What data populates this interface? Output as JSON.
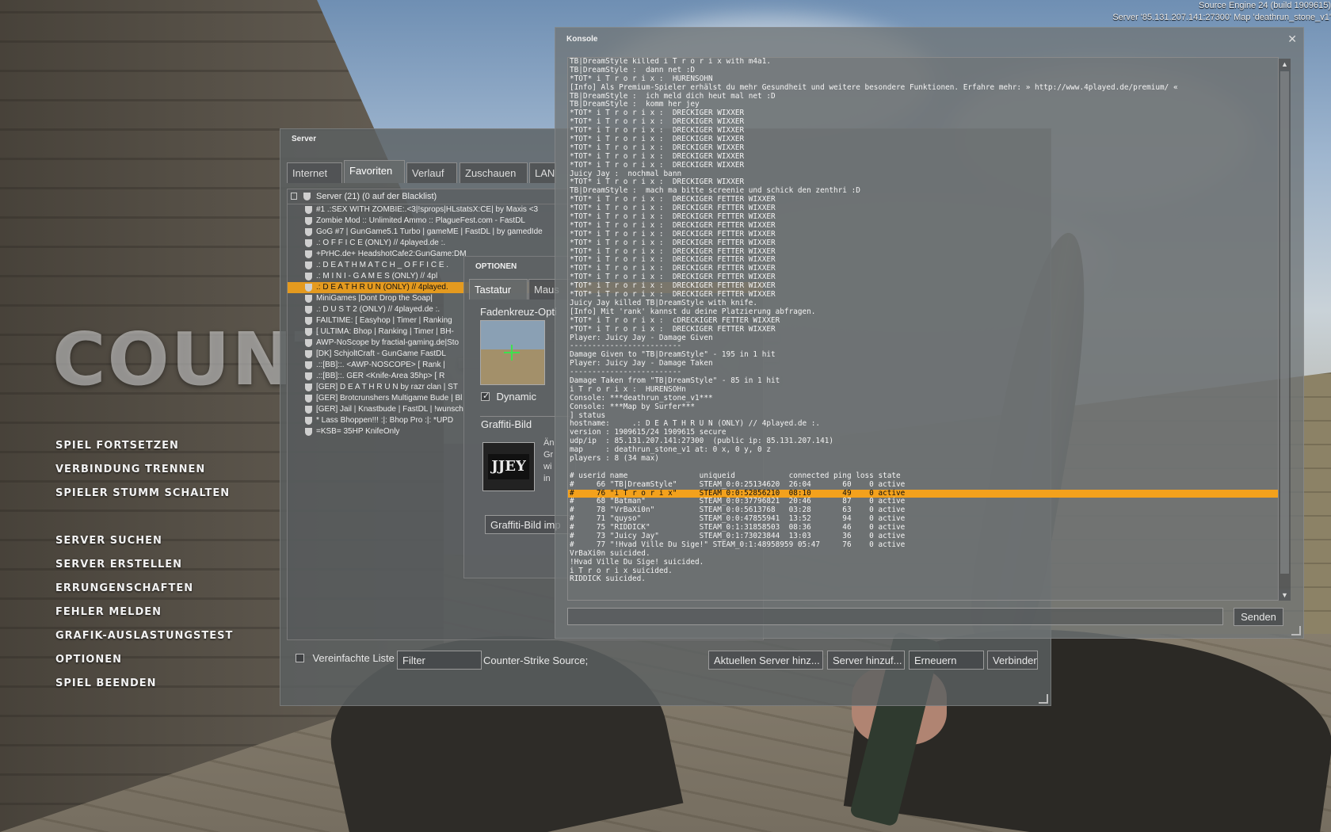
{
  "engine": {
    "line1": "Source Engine 24 (build 1909615)",
    "line2": "Server '85.131.207.141:27300' Map 'deathrun_stone_v1'"
  },
  "logo": "COUNTER-STRIKE",
  "menu": {
    "group1": [
      "SPIEL FORTSETZEN",
      "VERBINDUNG TRENNEN",
      "SPIELER STUMM SCHALTEN"
    ],
    "group2": [
      "SERVER SUCHEN",
      "SERVER ERSTELLEN",
      "ERRUNGENSCHAFTEN",
      "FEHLER MELDEN",
      "GRAFIK-AUSLASTUNGSTEST",
      "OPTIONEN",
      "SPIEL BEENDEN"
    ]
  },
  "server_browser": {
    "title": "Server",
    "tabs": [
      "Internet",
      "Favoriten",
      "Verlauf",
      "Zuschauen",
      "LAN"
    ],
    "active_tab": "Favoriten",
    "list_header": "Server (21) (0 auf der Blacklist)",
    "rows": [
      "#1 .:SEX WITH ZOMBIE:.<3|!sprops|HLstatsX:CE| by Maxis <3",
      "Zombie Mod :: Unlimited Ammo :: PlagueFest.com - FastDL",
      "GoG #7 | GunGame5.1 Turbo | gameME | FastDL | by gamedIde",
      "     .: O F F I C E (ONLY) // 4played.de :.",
      "+PrHC.de+ HeadshotCafe2:GunGame:DM",
      "     .: D E A T H M A T C H _ O F F I C E .",
      "     .: M I N I - G A M E S (ONLY) // 4pl",
      "     .: D E A T H R U N (ONLY) // 4played.",
      "MiniGames |Dont Drop the Soap|",
      "     .: D U S T 2 (ONLY) // 4played.de :.",
      "FAILTIME: [ Easyhop | Timer | Ranking",
      "[ ULTIMA: Bhop | Ranking | Timer | BH-",
      "AWP-NoScope by fractial-gaming.de|Sto",
      "[DK] SchjoltCraft - GunGame FastDL",
      ".::[BB]::. <AWP-NOSCOPE> [ Rank |",
      ".::[BB]::. GER <Knife-Area 35hp> [ R",
      "[GER] D E A T H R U N by razr clan | ST",
      "[GER] Brotcrunshers Multigame Bude | Bl",
      "[GER] Jail | Knastbude | FastDL | !wunsch",
      "* Lass Bhoppen!!! :|: Bhop Pro :|: *UPD",
      "=KSB= 35HP KnifeOnly"
    ],
    "selected_row": 7,
    "bottom": {
      "simple_list_label": "Vereinfachte Liste",
      "filter_value": "Filter",
      "filter_status": "Counter-Strike Source;",
      "add_current": "Aktuellen Server hinz...",
      "add_server": "Server hinzuf...",
      "refresh": "Erneuern",
      "connect": "Verbinden"
    }
  },
  "options": {
    "title": "OPTIONEN",
    "tabs": [
      "Tastatur",
      "Maus"
    ],
    "crosshair_label": "Fadenkreuz-Opti",
    "dynamic_label": "Dynamic",
    "graffiti_label": "Graffiti-Bild",
    "graffiti_text": [
      "Än",
      "Gr",
      "wi",
      "in"
    ],
    "import_button": "Graffiti-Bild imp",
    "spray_text": "JJEY"
  },
  "console": {
    "title": "Konsole",
    "send_button": "Senden",
    "input_value": "",
    "highlight_line": 50,
    "lines": [
      "TB|DreamStyle killed i T r o r i x with m4a1.",
      "TB|DreamStyle :  dann net :D",
      "*TOT* i T r o r i x :  HURENSOHN",
      "[Info] Als Premium-Spieler erhälst du mehr Gesundheit und weitere besondere Funktionen. Erfahre mehr: » http://www.4played.de/premium/ «",
      "TB|DreamStyle :  ich meld dich heut mal net :D",
      "TB|DreamStyle :  komm her jey",
      "*TOT* i T r o r i x :  DRECKIGER WIXXER",
      "*TOT* i T r o r i x :  DRECKIGER WIXXER",
      "*TOT* i T r o r i x :  DRECKIGER WIXXER",
      "*TOT* i T r o r i x :  DRECKIGER WIXXER",
      "*TOT* i T r o r i x :  DRECKIGER WIXXER",
      "*TOT* i T r o r i x :  DRECKIGER WIXXER",
      "*TOT* i T r o r i x :  DRECKIGER WIXXER",
      "Juicy Jay :  nochmal bann",
      "*TOT* i T r o r i x :  DRECKIGER WIXXER",
      "TB|DreamStyle :  mach ma bitte screenie und schick den zenthri :D",
      "*TOT* i T r o r i x :  DRECKIGER FETTER WIXXER",
      "*TOT* i T r o r i x :  DRECKIGER FETTER WIXXER",
      "*TOT* i T r o r i x :  DRECKIGER FETTER WIXXER",
      "*TOT* i T r o r i x :  DRECKIGER FETTER WIXXER",
      "*TOT* i T r o r i x :  DRECKIGER FETTER WIXXER",
      "*TOT* i T r o r i x :  DRECKIGER FETTER WIXXER",
      "*TOT* i T r o r i x :  DRECKIGER FETTER WIXXER",
      "*TOT* i T r o r i x :  DRECKIGER FETTER WIXXER",
      "*TOT* i T r o r i x :  DRECKIGER FETTER WIXXER",
      "*TOT* i T r o r i x :  DRECKIGER FETTER WIXXER",
      "*TOT* i T r o r i x :  DRECKIGER FETTER WIXXER",
      "*TOT* i T r o r i x :  DRECKIGER FETTER WIXXER",
      "Juicy Jay killed TB|DreamStyle with knife.",
      "[Info] Mit 'rank' kannst du deine Platzierung abfragen.",
      "*TOT* i T r o r i x :  cDRECKIGER FETTER WIXXER",
      "*TOT* i T r o r i x :  DRECKIGER FETTER WIXXER",
      "Player: Juicy Jay - Damage Given",
      "-------------------------",
      "Damage Given to \"TB|DreamStyle\" - 195 in 1 hit",
      "Player: Juicy Jay - Damage Taken",
      "-------------------------",
      "Damage Taken from \"TB|DreamStyle\" - 85 in 1 hit",
      "i T r o r i x :  HURENSOHn",
      "Console: ***deathrun_stone_v1***",
      "Console: ***Map by Surfer***",
      "] status",
      "hostname:     .: D E A T H R U N (ONLY) // 4played.de :.",
      "version : 1909615/24 1909615 secure",
      "udp/ip  : 85.131.207.141:27300  (public ip: 85.131.207.141)",
      "map     : deathrun_stone_v1 at: 0 x, 0 y, 0 z",
      "players : 8 (34 max)",
      "",
      "# userid name                uniqueid            connected ping loss state",
      "#     66 \"TB|DreamStyle\"     STEAM_0:0:25134620  26:04       60    0 active",
      "#     76 \"i T r o r i x\"     STEAM_0:0:52856210  08:10       49    0 active",
      "#     68 \"Batman\"            STEAM_0:0:37796821  20:46       87    0 active",
      "#     78 \"VrBaXi0n\"          STEAM_0:0:5613768   03:28       63    0 active",
      "#     71 \"quyso\"             STEAM_0:0:47855941  13:52       94    0 active",
      "#     75 \"RIDDICK\"           STEAM_0:1:31858503  08:36       46    0 active",
      "#     73 \"Juicy Jay\"         STEAM_0:1:73023844  13:03       36    0 active",
      "#     77 \"!Hvad Ville Du Sige!\" STEAM_0:1:48958959 05:47     76    0 active",
      "VrBaXi0n suicided.",
      "!Hvad Ville Du Sige! suicided.",
      "i T r o r i x suicided.",
      "RIDDICK suicided."
    ]
  }
}
